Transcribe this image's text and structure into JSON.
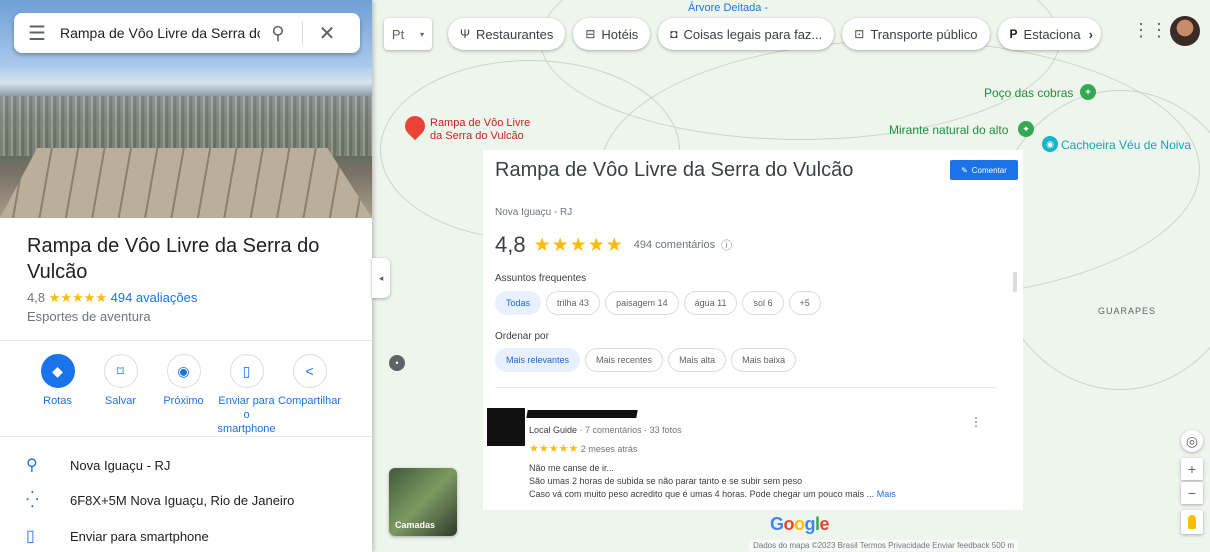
{
  "search": {
    "value": "Rampa de Vôo Livre da Serra do"
  },
  "place": {
    "title": "Rampa de Vôo Livre da Serra do Vulcão",
    "rating": "4,8",
    "stars": "★★★★★",
    "reviews": "494 avaliações",
    "category": "Esportes de aventura",
    "actions": [
      {
        "label": "Rotas",
        "icon": "◆"
      },
      {
        "label": "Salvar",
        "icon": "⌑"
      },
      {
        "label": "Próximo",
        "icon": "◉"
      },
      {
        "label": "Enviar para o smartphone",
        "icon": "▯"
      },
      {
        "label": "Compartilhar",
        "icon": "<"
      }
    ],
    "info": [
      {
        "icon": "⚲",
        "text": "Nova Iguaçu - RJ"
      },
      {
        "icon": "⁛",
        "text": "6F8X+5M Nova Iguaçu, Rio de Janeiro"
      },
      {
        "icon": "▯",
        "text": "Enviar para smartphone"
      }
    ]
  },
  "topbar": {
    "pt": "Pt",
    "chips": [
      {
        "icon": "Ψ",
        "label": "Restaurantes"
      },
      {
        "icon": "⊟",
        "label": "Hotéis"
      },
      {
        "icon": "◘",
        "label": "Coisas legais para faz..."
      },
      {
        "icon": "⊡",
        "label": "Transporte público"
      },
      {
        "icon": "P",
        "label": "Estaciona"
      }
    ]
  },
  "map": {
    "labels": {
      "arvore": "Árvore Deitada -",
      "poco": "Poço das cobras",
      "mirante": "Mirante natural do alto",
      "cachoeira": "Cachoeira Véu de Noiva",
      "guarapes": "GUARAPES",
      "rampa": "Rampa de Vôo Livre da Serra do Vulcão"
    },
    "layers": "Camadas",
    "google": "Google",
    "footer": "Dados do mapa ©2023   Brasil   Termos   Privacidade   Enviar feedback   500 m"
  },
  "card": {
    "title": "Rampa de Vôo Livre da Serra do Vulcão",
    "subtitle": "Nova Iguaçu - RJ",
    "edit": "Comentar",
    "rating": "4,8",
    "stars": "★★★★★",
    "count": "494 comentários",
    "topics_label": "Assuntos frequentes",
    "topics": [
      "Todas",
      "trilha 43",
      "paisagem 14",
      "água 11",
      "sol 6",
      "+5"
    ],
    "order_label": "Ordenar por",
    "order": [
      "Mais relevantes",
      "Mais recentes",
      "Mais alta",
      "Mais baixa"
    ],
    "review": {
      "meta_guide": "Local Guide",
      "meta": " · 7 comentários · 33 fotos",
      "stars": "★★★★★",
      "time": "2 meses atrás",
      "lines": [
        "Não me canse de ir...",
        "São umas 2 horas de subida se não parar tanto e se subir sem peso",
        "Caso vá com muito peso acredito que é umas 4 horas. Pode chegar um pouco mais ..."
      ],
      "more": "Mais"
    }
  }
}
